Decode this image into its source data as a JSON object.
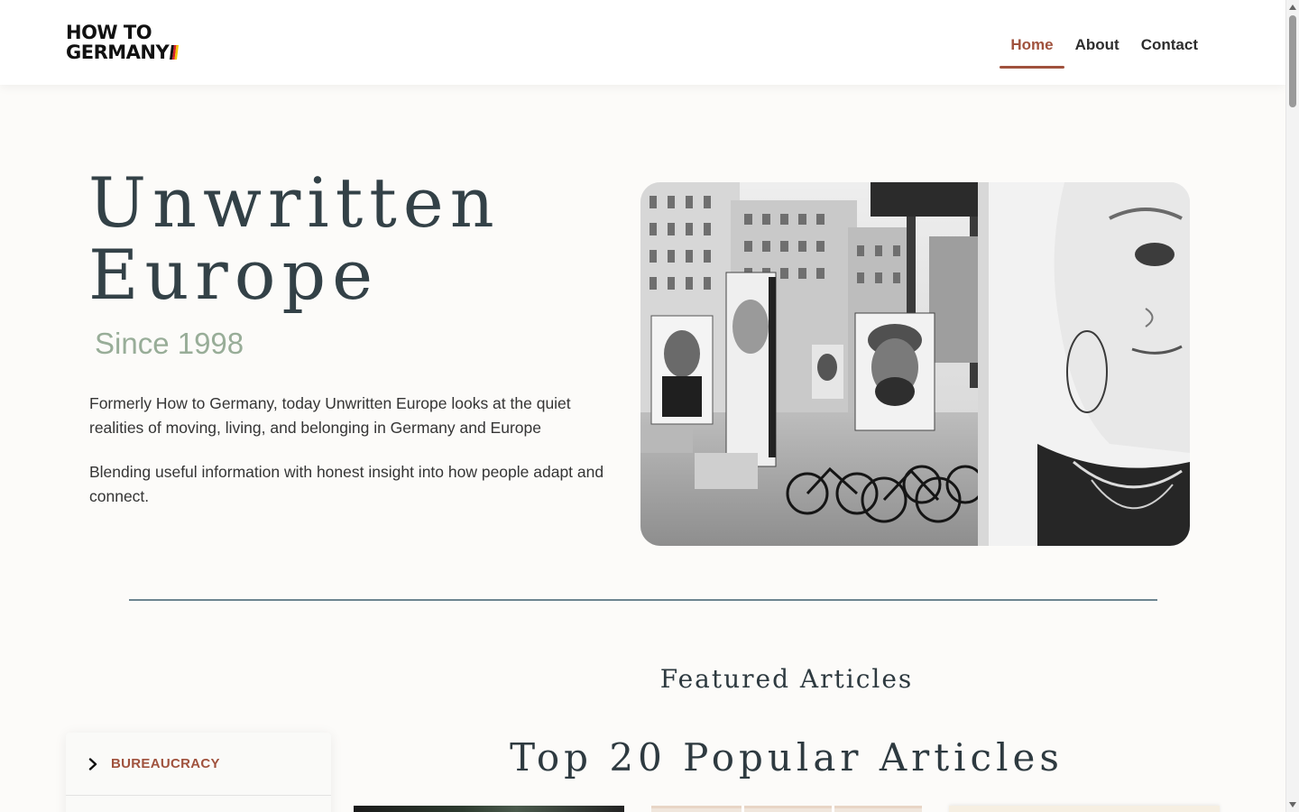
{
  "header": {
    "logo_line1": "HOW TO",
    "logo_line2": "GERMANY",
    "nav": [
      {
        "label": "Home",
        "active": true
      },
      {
        "label": "About",
        "active": false
      },
      {
        "label": "Contact",
        "active": false
      }
    ]
  },
  "hero": {
    "title_line1": "Unwritten",
    "title_line2": "Europe",
    "since": "Since 1998",
    "paragraph1": "Formerly How to Germany, today Unwritten Europe looks at the quiet realities of moving, living, and belonging in Germany and Europe",
    "paragraph2": "Blending useful information with honest insight into how people adapt and connect.",
    "image_alt": "Black and white street photo of portrait exhibition with bicycles in a city square"
  },
  "featured": {
    "heading": "Featured Articles",
    "popular_heading": "Top 20 Popular Articles"
  },
  "sidebar": {
    "categories": [
      {
        "label": "BUREAUCRACY"
      }
    ]
  },
  "colors": {
    "accent": "#a0523d",
    "title": "#334147",
    "since": "#98ad98",
    "divider": "#6d8590",
    "background": "#fcfbf9"
  },
  "icons": {
    "category_chevron": "chevron-right-icon",
    "logo_mark": "german-flag-stripes"
  }
}
